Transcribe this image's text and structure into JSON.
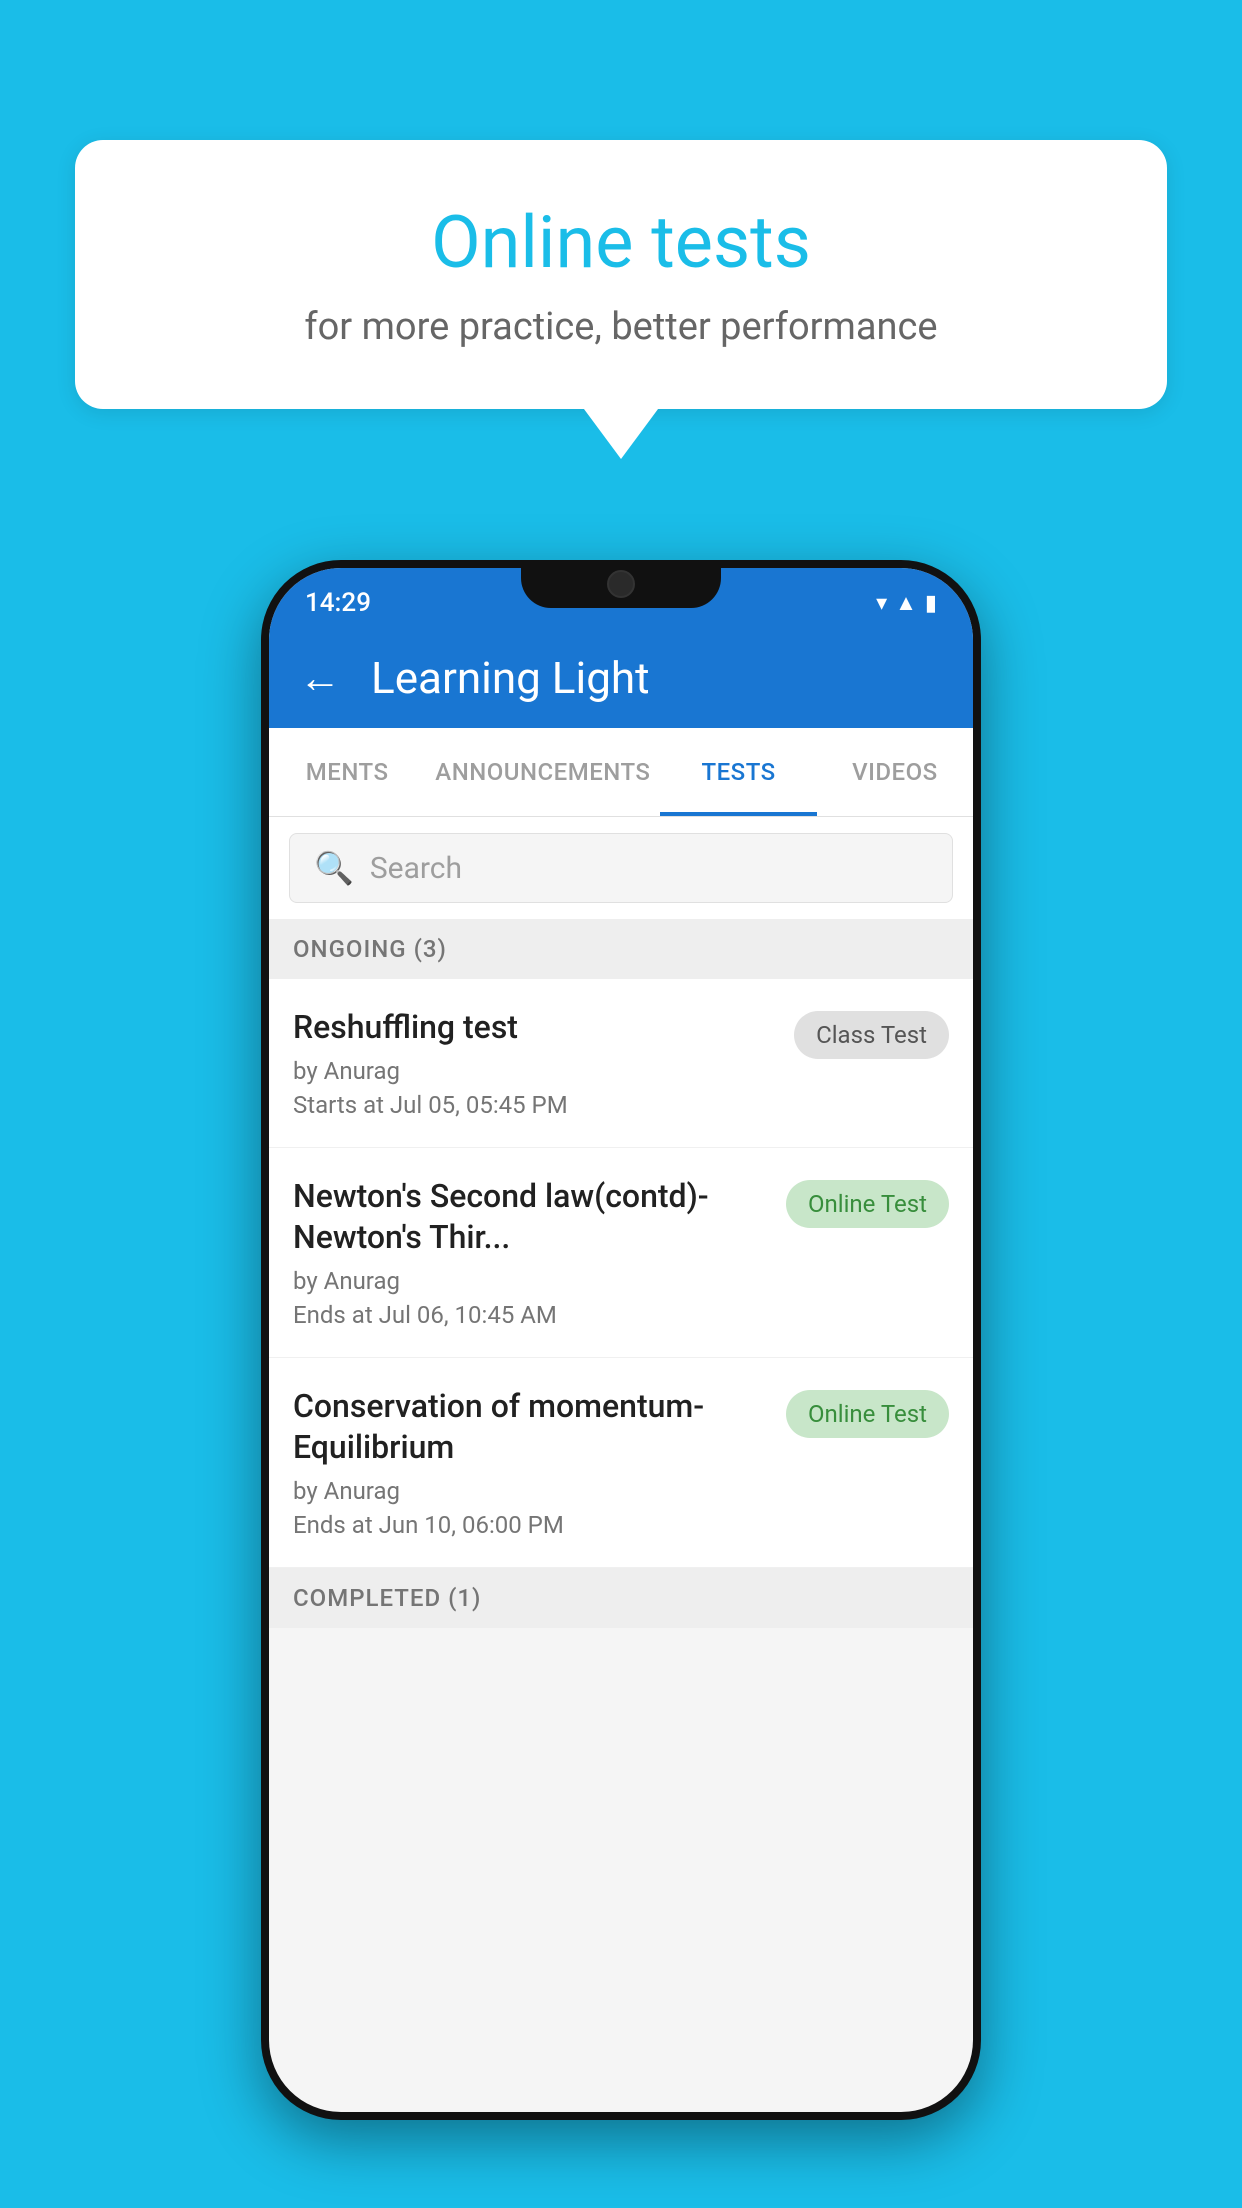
{
  "background_color": "#1ABDE8",
  "speech_bubble": {
    "title": "Online tests",
    "subtitle": "for more practice, better performance"
  },
  "phone": {
    "status_bar": {
      "time": "14:29",
      "icons": [
        "wifi",
        "signal",
        "battery"
      ]
    },
    "app_bar": {
      "title": "Learning Light",
      "back_label": "←"
    },
    "tabs": [
      {
        "label": "MENTS",
        "active": false
      },
      {
        "label": "ANNOUNCEMENTS",
        "active": false
      },
      {
        "label": "TESTS",
        "active": true
      },
      {
        "label": "VIDEOS",
        "active": false
      }
    ],
    "search": {
      "placeholder": "Search"
    },
    "sections": [
      {
        "title": "ONGOING (3)",
        "items": [
          {
            "name": "Reshuffling test",
            "author": "by Anurag",
            "time": "Starts at  Jul 05, 05:45 PM",
            "badge": "Class Test",
            "badge_type": "class"
          },
          {
            "name": "Newton's Second law(contd)-Newton's Thir...",
            "author": "by Anurag",
            "time": "Ends at  Jul 06, 10:45 AM",
            "badge": "Online Test",
            "badge_type": "online"
          },
          {
            "name": "Conservation of momentum-Equilibrium",
            "author": "by Anurag",
            "time": "Ends at  Jun 10, 06:00 PM",
            "badge": "Online Test",
            "badge_type": "online"
          }
        ]
      },
      {
        "title": "COMPLETED (1)",
        "items": []
      }
    ]
  }
}
